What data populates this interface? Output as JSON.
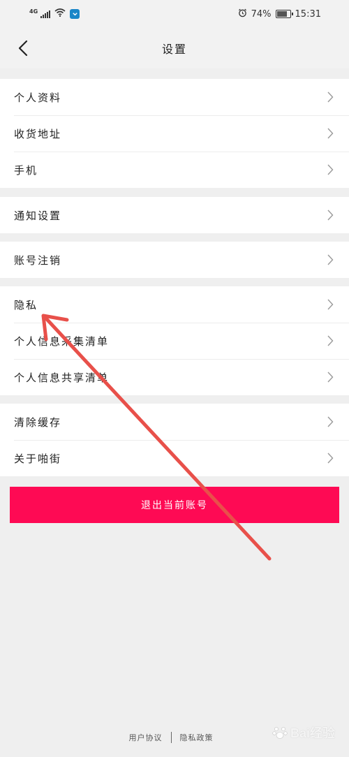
{
  "status_bar": {
    "network": "4G",
    "battery_text": "74%",
    "time": "15:31"
  },
  "header": {
    "title": "设置"
  },
  "sections": [
    {
      "items": [
        {
          "label": "个人资料"
        },
        {
          "label": "收货地址"
        },
        {
          "label": "手机"
        }
      ]
    },
    {
      "items": [
        {
          "label": "通知设置"
        }
      ]
    },
    {
      "items": [
        {
          "label": "账号注销"
        }
      ]
    },
    {
      "items": [
        {
          "label": "隐私"
        },
        {
          "label": "个人信息采集清单"
        },
        {
          "label": "个人信息共享清单"
        }
      ]
    },
    {
      "items": [
        {
          "label": "清除缓存"
        },
        {
          "label": "关于啪街"
        }
      ]
    }
  ],
  "logout": {
    "label": "退出当前账号",
    "color": "#fe0a54"
  },
  "footer": {
    "user_agreement": "用户协议",
    "privacy_policy": "隐私政策"
  },
  "watermark": {
    "text": "Bai经验"
  },
  "annotation": {
    "color": "#e8504a"
  }
}
